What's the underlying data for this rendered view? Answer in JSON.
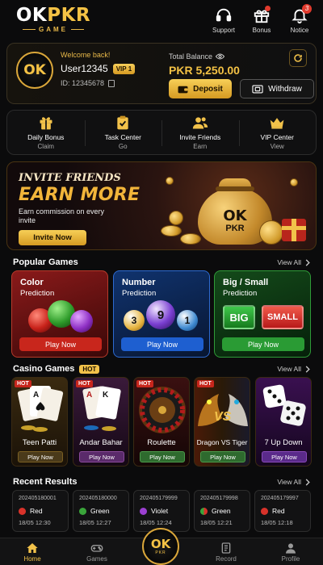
{
  "logo": {
    "main_left": "OK",
    "main_right": "PKR",
    "sub": "GAME"
  },
  "header": {
    "support": "Support",
    "bonus": "Bonus",
    "notice": "Notice",
    "notice_count": "3"
  },
  "user": {
    "welcome": "Welcome back!",
    "name": "User12345",
    "vip": "VIP 1",
    "id": "ID: 12345678",
    "avatar_text": "OK",
    "balance_label": "Total Balance",
    "balance": "PKR 5,250.00",
    "deposit": "Deposit",
    "withdraw": "Withdraw"
  },
  "quick_menu": [
    {
      "title": "Daily Bonus",
      "sub": "Claim",
      "icon": "gift-icon"
    },
    {
      "title": "Task Center",
      "sub": "Go",
      "icon": "clipboard-check-icon"
    },
    {
      "title": "Invite Friends",
      "sub": "Earn",
      "icon": "users-icon"
    },
    {
      "title": "VIP Center",
      "sub": "View",
      "icon": "crown-icon"
    }
  ],
  "banner": {
    "invite": "INVITE FRIENDS",
    "earn": "EARN MORE",
    "text": "Earn commission on every invite",
    "button": "Invite Now",
    "bag_top": "OK",
    "bag_bottom": "PKR"
  },
  "popular": {
    "title": "Popular Games",
    "view_all": "View All",
    "cards": [
      {
        "line1": "Color",
        "line2": "Prediction",
        "play": "Play Now"
      },
      {
        "line1": "Number",
        "line2": "Prediction",
        "play": "Play Now",
        "balls": [
          "3",
          "9",
          "1"
        ]
      },
      {
        "line1": "Big / Small",
        "line2": "Prediction",
        "play": "Play Now",
        "big": "BIG",
        "small": "SMALL"
      }
    ]
  },
  "casino": {
    "title": "Casino Games",
    "hot": "HOT",
    "view_all": "View All",
    "hot_label": "HOT",
    "games": [
      {
        "name": "Teen Patti",
        "play": "Play Now"
      },
      {
        "name": "Andar Bahar",
        "play": "Play Now"
      },
      {
        "name": "Roulette",
        "play": "Play Now"
      },
      {
        "name": "Dragon VS Tiger",
        "play": "Play Now",
        "vs": "VS"
      },
      {
        "name": "7 Up Down",
        "play": "Play Now"
      }
    ]
  },
  "results": {
    "title": "Recent Results",
    "view_all": "View All",
    "items": [
      {
        "id": "202405180001",
        "result": "Red",
        "time": "18/05 12:30",
        "color": "#d8322a"
      },
      {
        "id": "202405180000",
        "result": "Green",
        "time": "18/05 12:27",
        "color": "#3aa53a"
      },
      {
        "id": "202405179999",
        "result": "Violet",
        "time": "18/05 12:24",
        "color": "#9b3fd1"
      },
      {
        "id": "202405179998",
        "result": "Green",
        "time": "18/05 12:21",
        "color": "#3aa53a"
      },
      {
        "id": "202405179997",
        "result": "Red",
        "time": "18/05 12:18",
        "color": "#d8322a"
      }
    ]
  },
  "nav": {
    "home": "Home",
    "games": "Games",
    "center_top": "OK",
    "center_bottom": "PKR",
    "record": "Record",
    "profile": "Profile"
  },
  "colors": {
    "accent": "#f2c24a",
    "background": "#0b0b0c"
  }
}
